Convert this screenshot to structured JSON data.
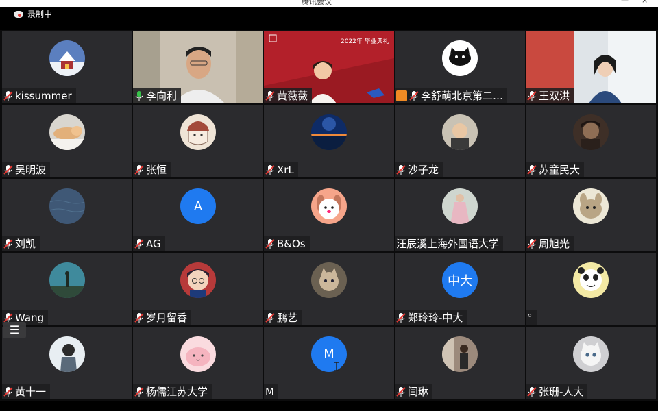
{
  "window": {
    "title": "腾讯会议",
    "minimize": "—",
    "close": "×"
  },
  "recording": {
    "label": "录制中"
  },
  "participants": [
    {
      "name": "kissummer",
      "mic": "muted",
      "avatar": "snow-house"
    },
    {
      "name": "李向利",
      "mic": "active",
      "avatar": "video-man",
      "speaking": true
    },
    {
      "name": "黄薇薇",
      "mic": "muted",
      "avatar": "video-ceremony",
      "banner": "2022年 毕业典礼"
    },
    {
      "name": "李舒萌北京第二…",
      "mic": "muted",
      "avatar": "black-cat",
      "host_badge": true
    },
    {
      "name": "王双洪",
      "mic": "muted",
      "avatar": "video-woman"
    },
    {
      "name": "吴明波",
      "mic": "muted",
      "avatar": "sleeping-cat"
    },
    {
      "name": "张恒",
      "mic": "muted",
      "avatar": "drawn-face"
    },
    {
      "name": "XrL",
      "mic": "muted",
      "avatar": "night-lake"
    },
    {
      "name": "沙子龙",
      "mic": "muted",
      "avatar": "child-photo"
    },
    {
      "name": "苏童民大",
      "mic": "muted",
      "avatar": "dark-portrait"
    },
    {
      "name": "刘凯",
      "mic": "muted",
      "avatar": "sea-water"
    },
    {
      "name": "AG",
      "mic": "muted",
      "avatar_letter": "A"
    },
    {
      "name": "B&Os",
      "mic": "muted",
      "avatar": "bunny-cartoon"
    },
    {
      "name": "汪辰溪上海外国语大学",
      "mic": "none",
      "avatar": "girl-dress"
    },
    {
      "name": "周旭光",
      "mic": "muted",
      "avatar": "rabbit-cartoon"
    },
    {
      "name": "Wang",
      "mic": "muted",
      "avatar": "silhouette-sky"
    },
    {
      "name": "岁月留香",
      "mic": "muted",
      "avatar": "anime-boy"
    },
    {
      "name": "鹏艺",
      "mic": "muted",
      "avatar": "kitten"
    },
    {
      "name": "郑玲玲-中大",
      "mic": "muted",
      "avatar_letter": "中大"
    },
    {
      "name": "°",
      "mic": "none",
      "avatar": "panda-meme"
    },
    {
      "name": "黄十一",
      "mic": "muted",
      "avatar": "girl-back"
    },
    {
      "name": "杨儒江苏大学",
      "mic": "muted",
      "avatar": "pink-blob"
    },
    {
      "name": "M",
      "mic": "none",
      "avatar_letter": "M"
    },
    {
      "name": "闫琳",
      "mic": "muted",
      "avatar": "room-photo"
    },
    {
      "name": "张珊-人大",
      "mic": "muted",
      "avatar": "white-cat"
    }
  ],
  "colors": {
    "tile": "#2b2b2e",
    "letter_avatar": "#1f7af0",
    "speaking": "#38c24a",
    "muted_mic": "#e53935"
  }
}
